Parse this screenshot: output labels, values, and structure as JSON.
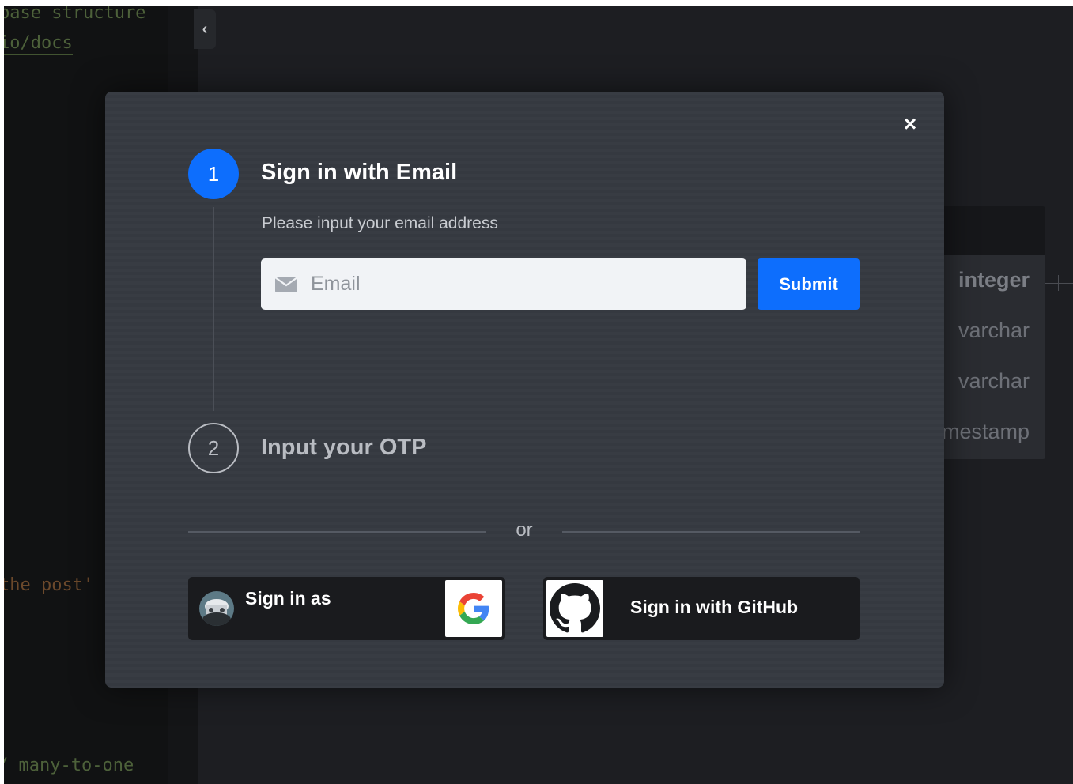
{
  "background": {
    "editor_lines": [
      {
        "text": "base structure"
      },
      {
        "text": "io/docs"
      },
      {
        "text": "the post'"
      },
      {
        "text": "/ many-to-one"
      }
    ],
    "collapse_toggle_glyph": "‹",
    "table_field_types": [
      "integer",
      "varchar",
      "varchar",
      "timestamp"
    ]
  },
  "modal": {
    "close_glyph": "×",
    "step1": {
      "number": "1",
      "title": "Sign in with Email",
      "description": "Please input your email address",
      "email_placeholder": "Email",
      "email_value": "",
      "submit_label": "Submit"
    },
    "step2": {
      "number": "2",
      "title": "Input your OTP"
    },
    "divider_text": "or",
    "google_button": {
      "label": "Sign in as",
      "icon": "google-logo-icon"
    },
    "github_button": {
      "label": "Sign in with GitHub",
      "icon": "github-logo-icon"
    }
  },
  "colors": {
    "accent": "#0d6efd",
    "modal_bg": "#363a41",
    "oauth_bg": "#1a1b1e"
  }
}
